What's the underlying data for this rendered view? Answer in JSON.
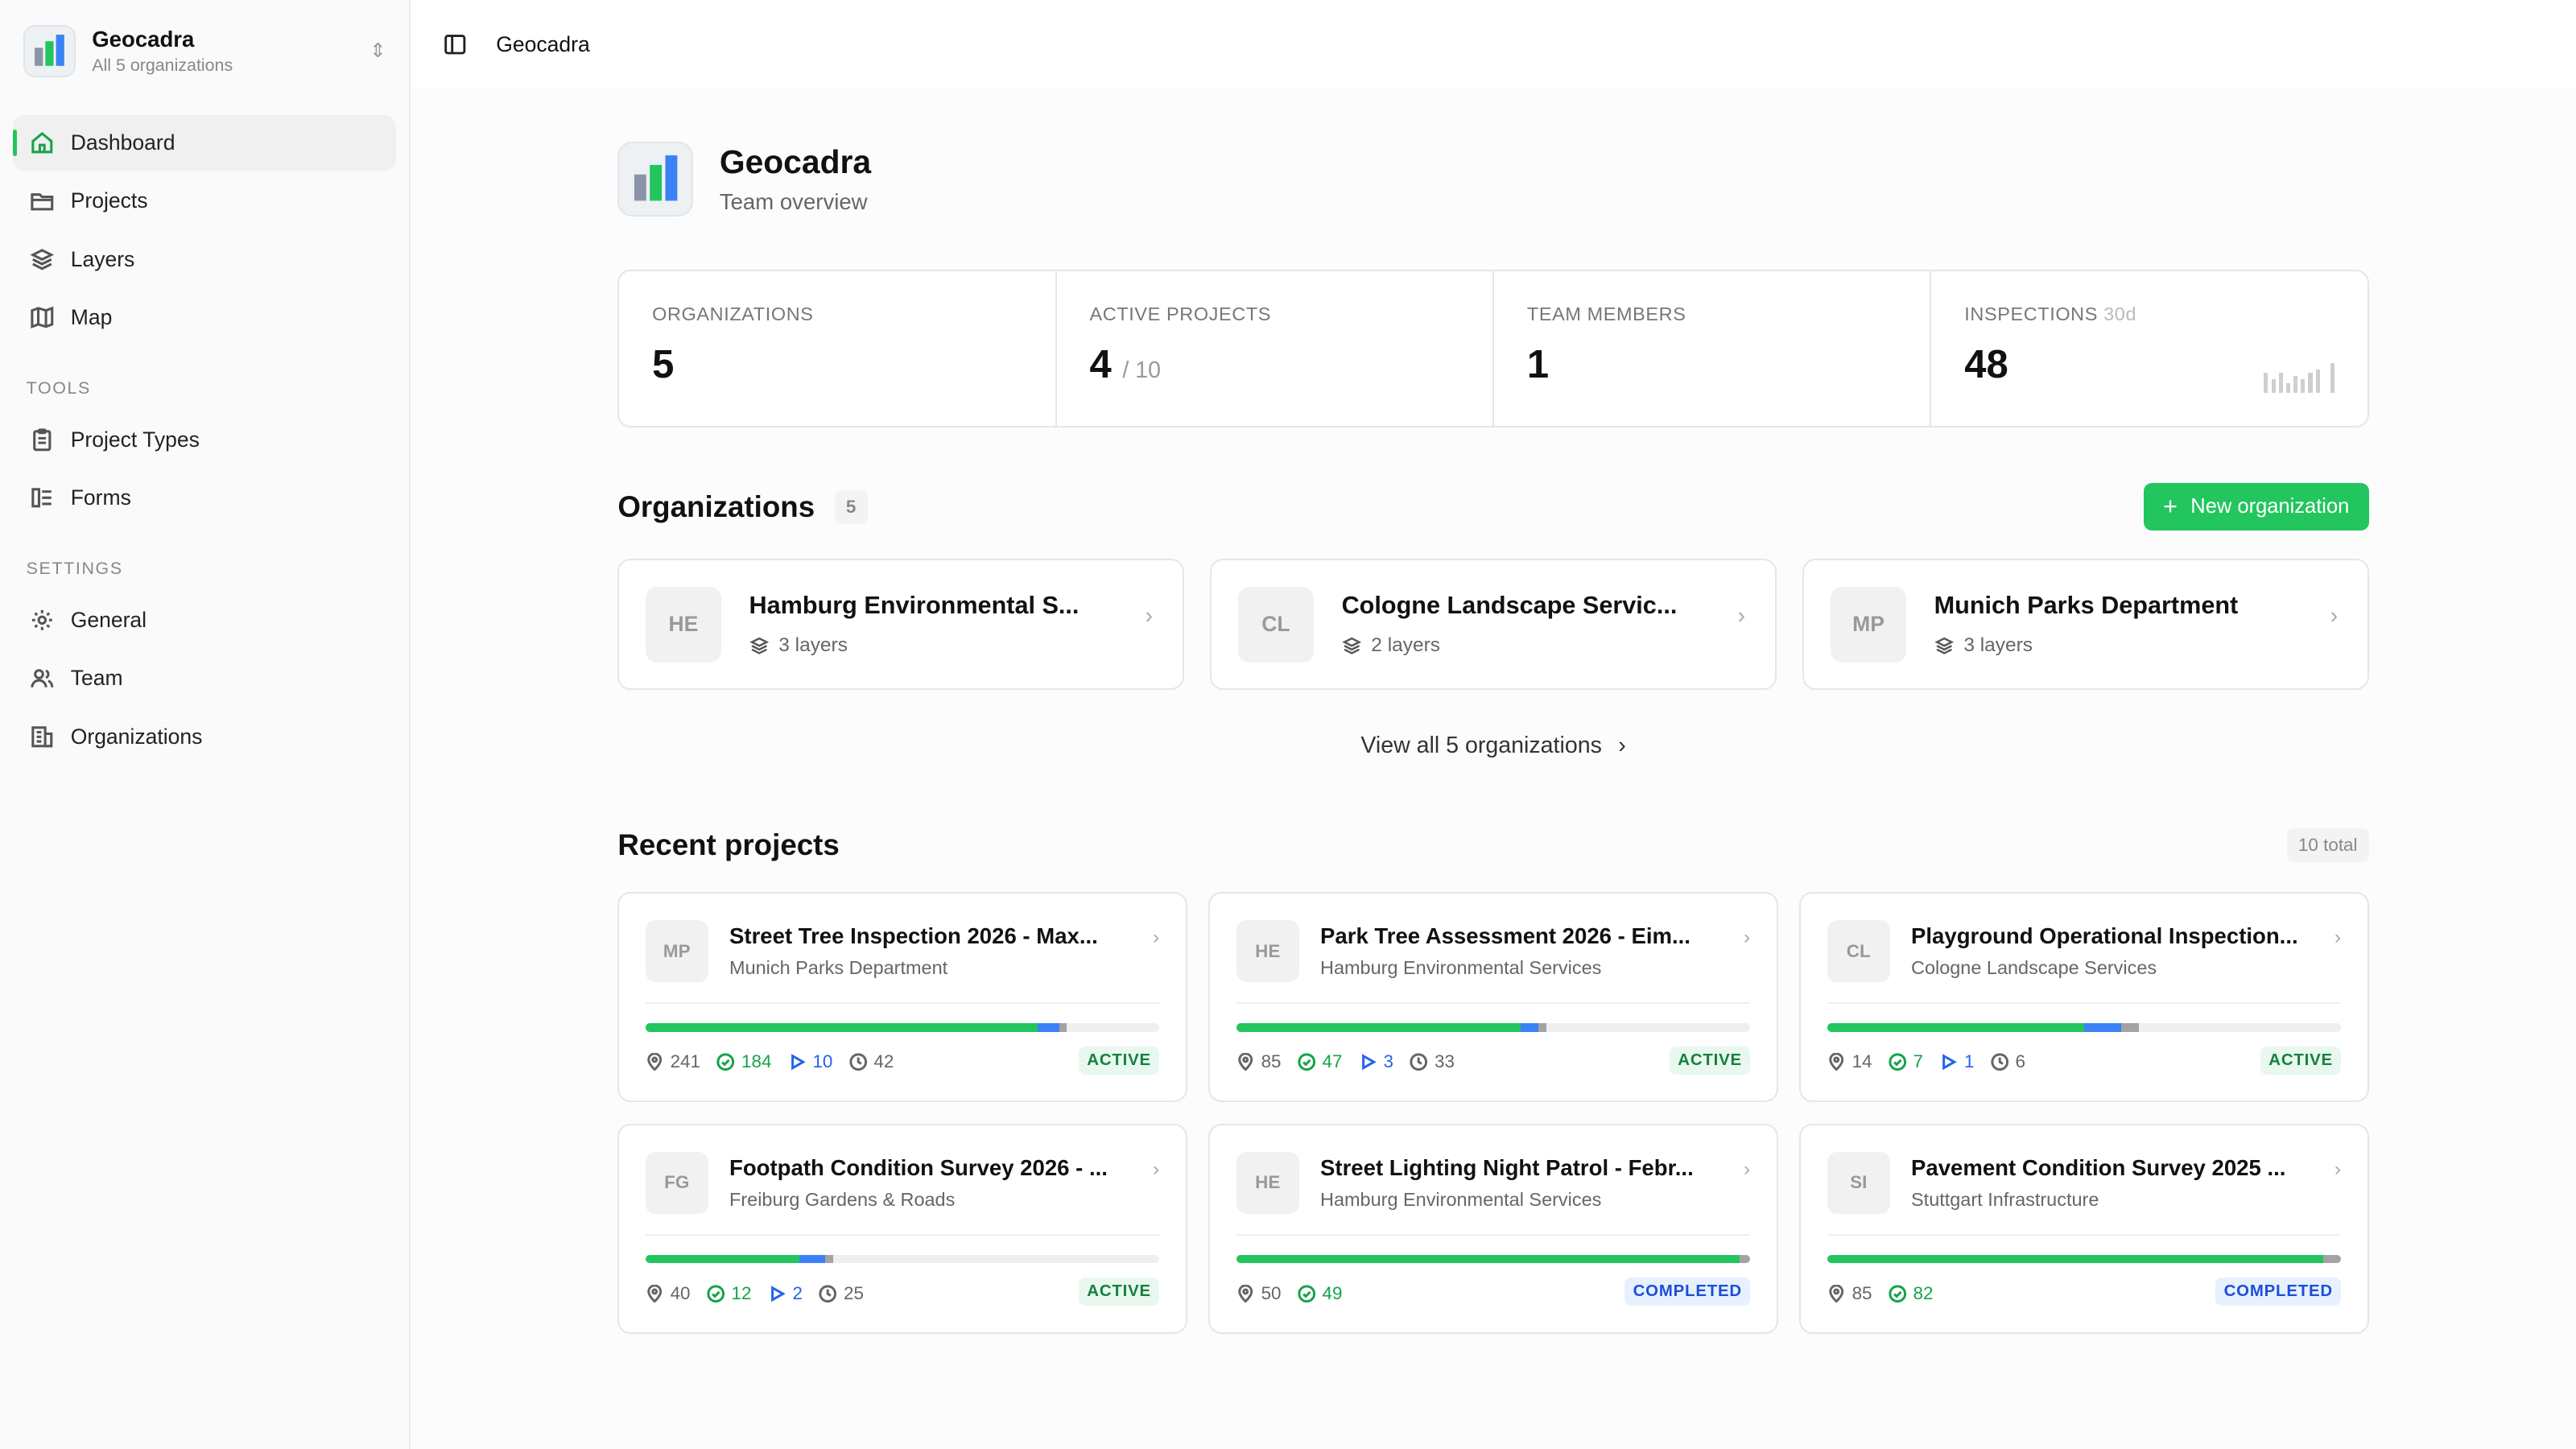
{
  "sidebar": {
    "org_name": "Geocadra",
    "org_sub": "All 5 organizations",
    "nav": [
      {
        "label": "Dashboard"
      },
      {
        "label": "Projects"
      },
      {
        "label": "Layers"
      },
      {
        "label": "Map"
      }
    ],
    "tools_label": "TOOLS",
    "tools": [
      {
        "label": "Project Types"
      },
      {
        "label": "Forms"
      }
    ],
    "settings_label": "SETTINGS",
    "settings": [
      {
        "label": "General"
      },
      {
        "label": "Team"
      },
      {
        "label": "Organizations"
      }
    ]
  },
  "topbar": {
    "breadcrumb": "Geocadra"
  },
  "header": {
    "title": "Geocadra",
    "subtitle": "Team overview"
  },
  "stats": [
    {
      "label": "ORGANIZATIONS",
      "value": "5"
    },
    {
      "label": "ACTIVE PROJECTS",
      "value": "4",
      "of": "/ 10"
    },
    {
      "label": "TEAM MEMBERS",
      "value": "1"
    },
    {
      "label": "INSPECTIONS",
      "label_suffix": "30d",
      "value": "48"
    }
  ],
  "organizations": {
    "title": "Organizations",
    "count": "5",
    "new_button": "New organization",
    "view_all": "View all 5 organizations",
    "cards": [
      {
        "initials": "HE",
        "name": "Hamburg Environmental S...",
        "layers": "3 layers"
      },
      {
        "initials": "CL",
        "name": "Cologne Landscape Servic...",
        "layers": "2 layers"
      },
      {
        "initials": "MP",
        "name": "Munich Parks Department",
        "layers": "3 layers"
      }
    ]
  },
  "projects": {
    "title": "Recent projects",
    "total": "10 total",
    "cards": [
      {
        "initials": "MP",
        "title": "Street Tree Inspection 2026 - Max...",
        "org": "Munich Parks Department",
        "features": "241",
        "done": "184",
        "in_progress": "10",
        "pending": "42",
        "status": "ACTIVE"
      },
      {
        "initials": "HE",
        "title": "Park Tree Assessment 2026 - Eim...",
        "org": "Hamburg Environmental Services",
        "features": "85",
        "done": "47",
        "in_progress": "3",
        "pending": "33",
        "status": "ACTIVE"
      },
      {
        "initials": "CL",
        "title": "Playground Operational Inspection...",
        "org": "Cologne Landscape Services",
        "features": "14",
        "done": "7",
        "in_progress": "1",
        "pending": "6",
        "status": "ACTIVE"
      },
      {
        "initials": "FG",
        "title": "Footpath Condition Survey 2026 - ...",
        "org": "Freiburg Gardens & Roads",
        "features": "40",
        "done": "12",
        "in_progress": "2",
        "pending": "25",
        "status": "ACTIVE"
      },
      {
        "initials": "HE",
        "title": "Street Lighting Night Patrol - Febr...",
        "org": "Hamburg Environmental Services",
        "features": "50",
        "done": "49",
        "status": "COMPLETED"
      },
      {
        "initials": "SI",
        "title": "Pavement Condition Survey 2025 ...",
        "org": "Stuttgart Infrastructure",
        "features": "85",
        "done": "82",
        "status": "COMPLETED"
      }
    ]
  },
  "colors": {
    "accent": "#22c55e",
    "progress_blue": "#3b82f6",
    "progress_gray": "#a3a3a3"
  }
}
